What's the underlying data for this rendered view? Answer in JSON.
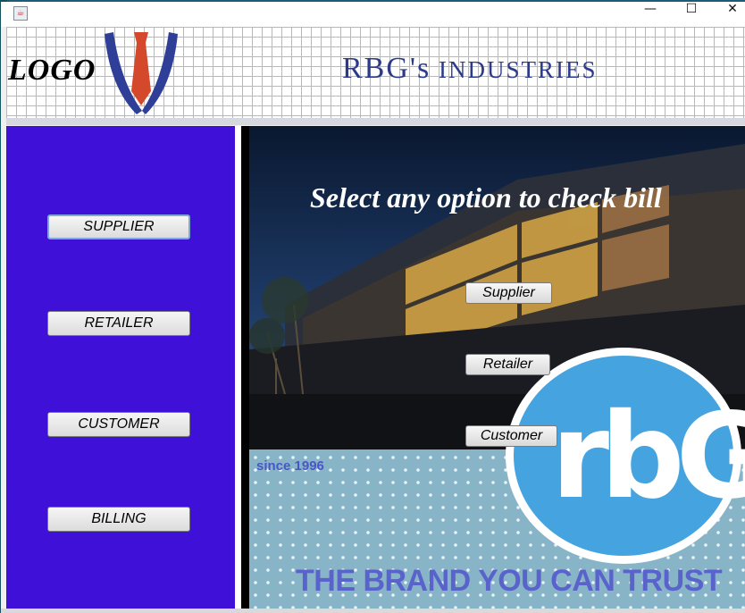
{
  "window": {
    "controls": {
      "minimize": "—",
      "maximize": "☐",
      "close": "✕"
    },
    "icon": "java-app-icon"
  },
  "header": {
    "logo_text": "LOGO",
    "logo_icon": "tie-icon",
    "company_initial": "RBG's",
    "company_rest": " INDUSTRIES"
  },
  "sidebar": {
    "items": [
      {
        "label": "SUPPLIER"
      },
      {
        "label": "RETAILER"
      },
      {
        "label": "CUSTOMER"
      },
      {
        "label": "BILLING"
      }
    ]
  },
  "content": {
    "headline": "Select any option to check bill",
    "buttons": [
      {
        "label": "Supplier"
      },
      {
        "label": "Retailer"
      },
      {
        "label": "Customer"
      }
    ],
    "since": "since 1996",
    "brand_mark": "rbG",
    "tagline": "THE BRAND YOU CAN TRUST"
  },
  "colors": {
    "sidebar": "#3f10d8",
    "company_text": "#2c3a8c",
    "circle": "#45a3e0",
    "tagline": "#5a62cc"
  }
}
